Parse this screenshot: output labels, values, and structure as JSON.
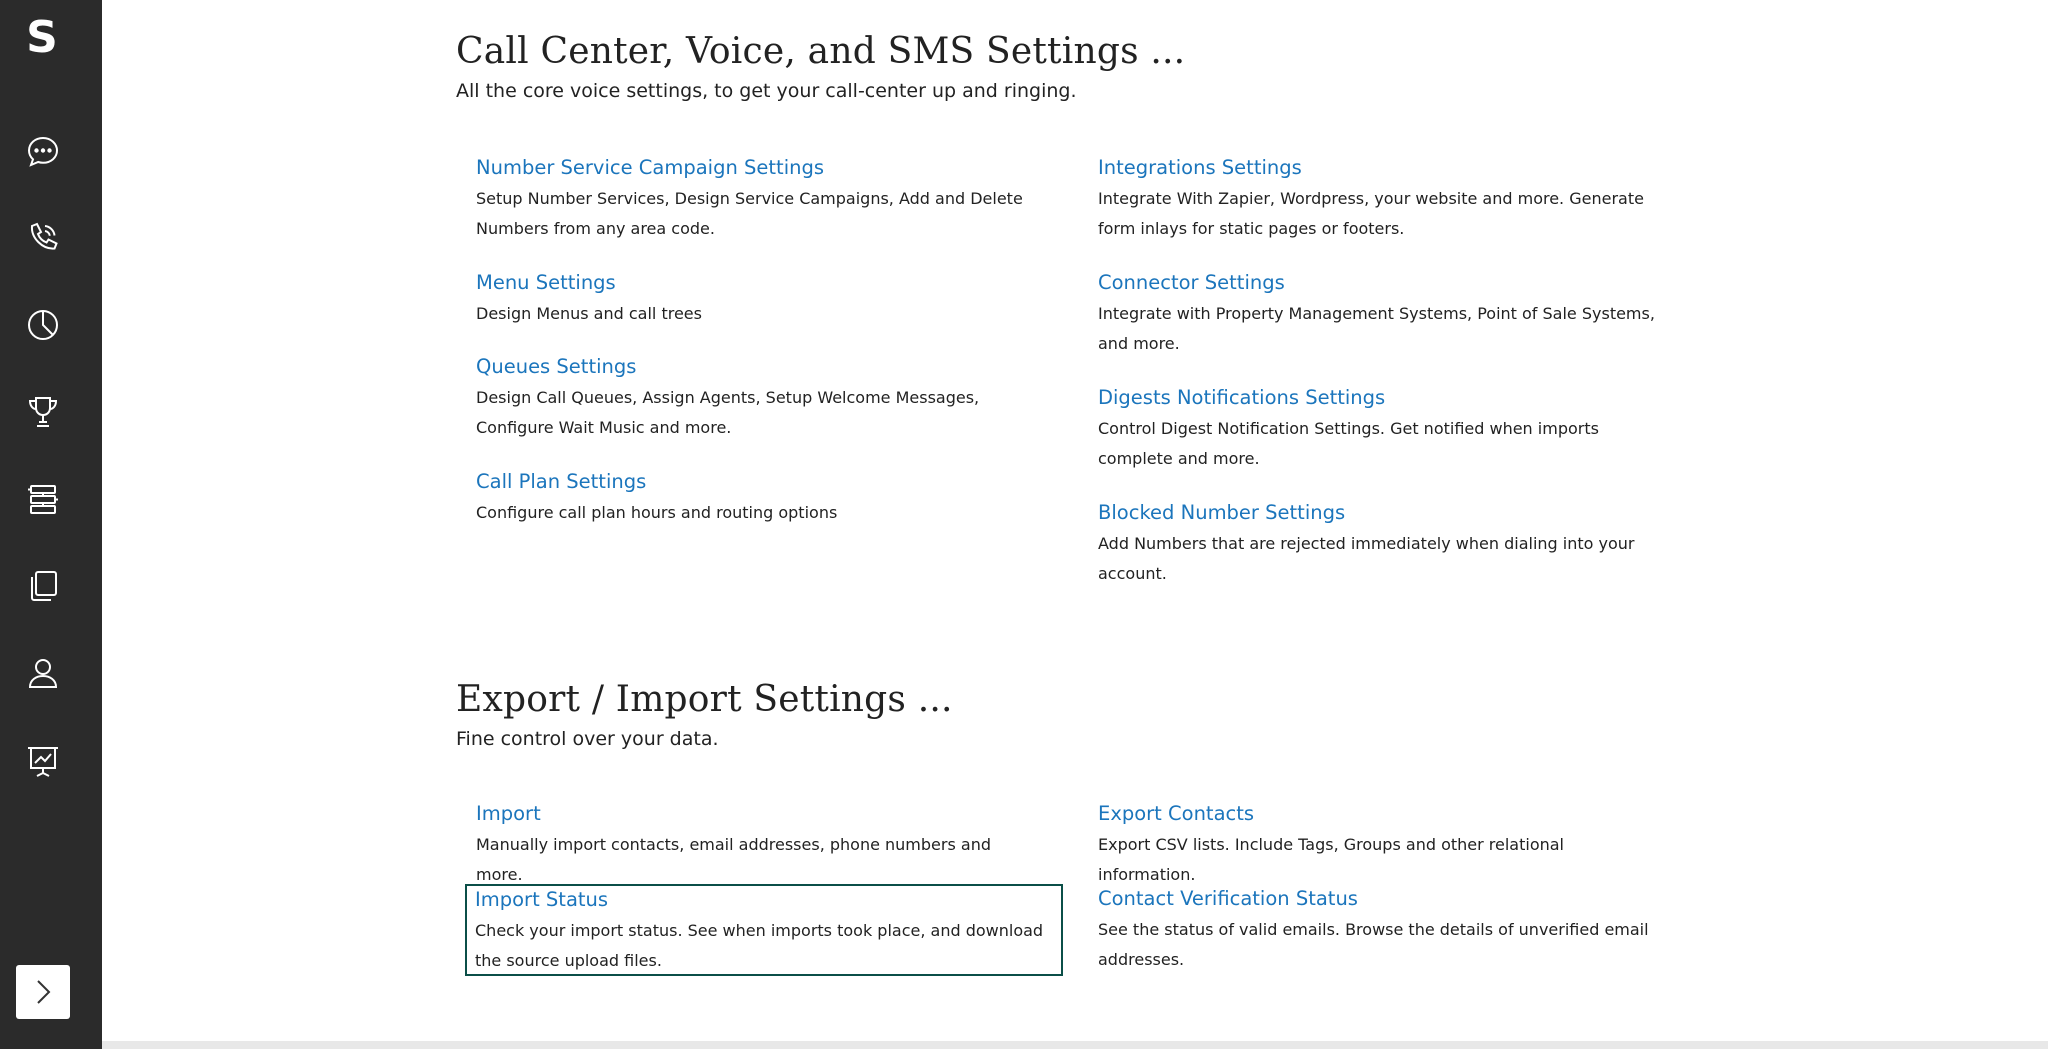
{
  "sidebar": {
    "logo": "S",
    "icons": [
      "chat-bubble-icon",
      "phone-icon",
      "pie-chart-icon",
      "trophy-icon",
      "flow-chart-icon",
      "copy-pages-icon",
      "user-icon",
      "presentation-chart-icon"
    ],
    "expand_icon": "chevron-right-icon"
  },
  "sections": [
    {
      "title": "Call Center, Voice, and SMS Settings ...",
      "subtitle": "All the core voice settings, to get your call-center up and ringing.",
      "left": [
        {
          "title": "Number Service Campaign Settings",
          "desc": "Setup Number Services, Design Service Campaigns, Add and Delete Numbers from any area code."
        },
        {
          "title": "Menu Settings",
          "desc": "Design Menus and call trees"
        },
        {
          "title": "Queues Settings",
          "desc": "Design Call Queues, Assign Agents, Setup Welcome Messages, Configure Wait Music and more."
        },
        {
          "title": "Call Plan Settings",
          "desc": "Configure call plan hours and routing options"
        }
      ],
      "right": [
        {
          "title": "Integrations Settings",
          "desc": "Integrate With Zapier, Wordpress, your website and more. Generate form inlays for static pages or footers."
        },
        {
          "title": "Connector Settings",
          "desc": "Integrate with Property Management Systems, Point of Sale Systems, and more."
        },
        {
          "title": "Digests Notifications Settings",
          "desc": "Control Digest Notification Settings. Get notified when imports complete and more."
        },
        {
          "title": "Blocked Number Settings",
          "desc": "Add Numbers that are rejected immediately when dialing into your account."
        }
      ]
    },
    {
      "title": "Export / Import Settings ...",
      "subtitle": "Fine control over your data.",
      "left": [
        {
          "title": "Import",
          "desc": "Manually import contacts, email addresses, phone numbers and more."
        },
        {
          "title": "Import Status",
          "desc": "Check your import status. See when imports took place, and download the source upload files."
        }
      ],
      "right": [
        {
          "title": "Export Contacts",
          "desc": "Export CSV lists. Include Tags, Groups and other relational information."
        },
        {
          "title": "Contact Verification Status",
          "desc": "See the status of valid emails. Browse the details of unverified email addresses."
        }
      ]
    }
  ],
  "colors": {
    "sidebar_bg": "#2b2b2b",
    "link": "#1b75bc",
    "focus_border": "#0b4f48"
  }
}
